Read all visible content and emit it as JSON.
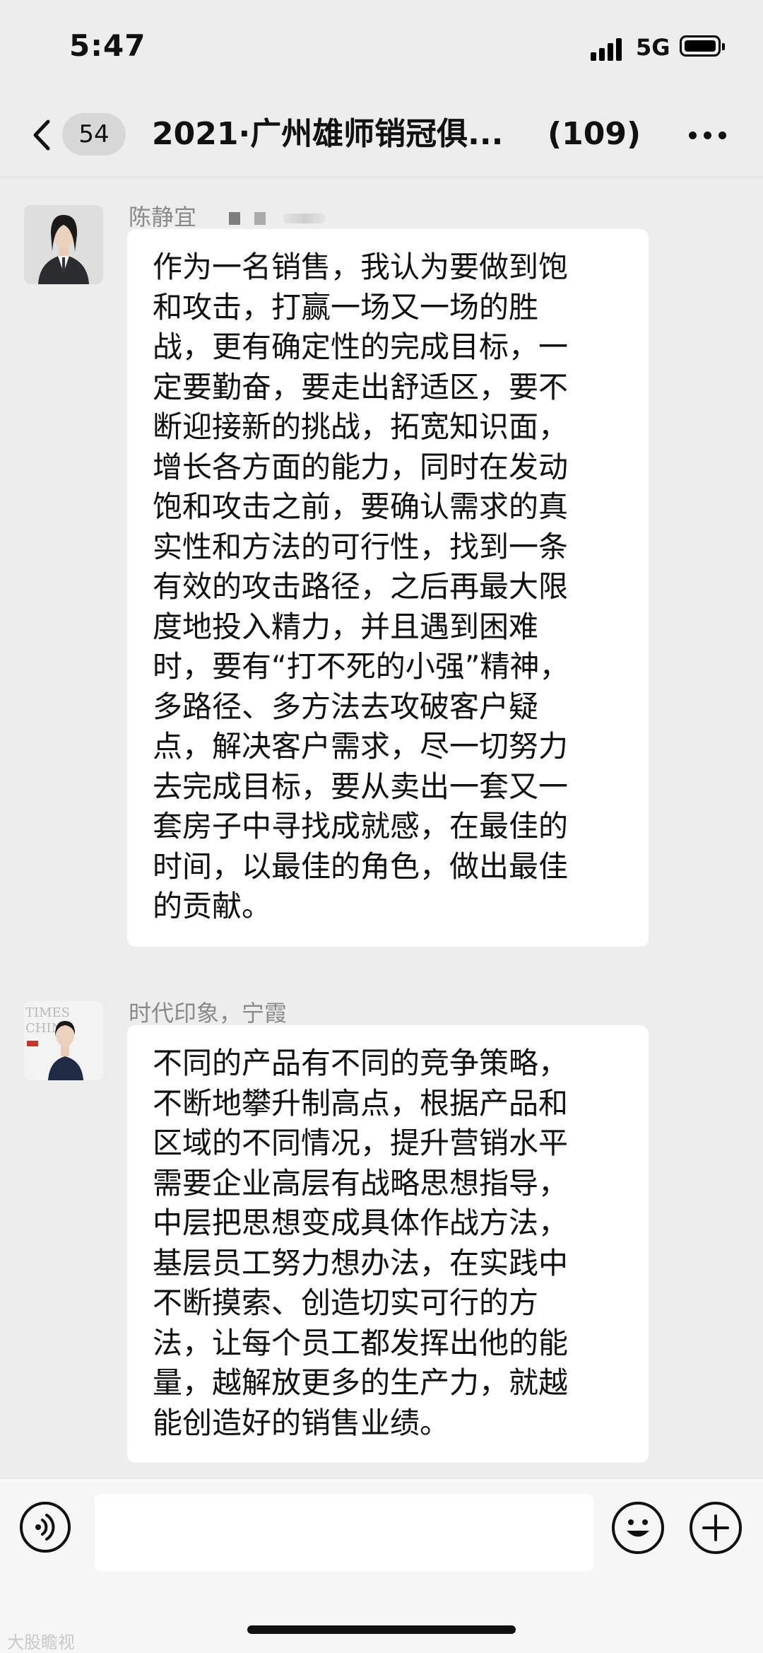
{
  "status_bar": {
    "time": "5:47",
    "network": "5G"
  },
  "header": {
    "unread_count": "54",
    "title": "2021·广州雄师销冠俱...",
    "member_count": "(109)"
  },
  "messages": [
    {
      "sender": "陈静宜",
      "lines": [
        "作为一名销售，我认为要做到饱",
        "和攻击，打赢一场又一场的胜",
        "战，更有确定性的完成目标，一",
        "定要勤奋，要走出舒适区，要不",
        "断迎接新的挑战，拓宽知识面，",
        "增长各方面的能力，同时在发动",
        "饱和攻击之前，要确认需求的真",
        "实性和方法的可行性，找到一条",
        "有效的攻击路径，之后再最大限",
        "度地投入精力，并且遇到困难",
        "时，要有“打不死的小强”精神，",
        "多路径、多方法去攻破客户疑",
        "点，解决客户需求，尽一切努力",
        "去完成目标，要从卖出一套又一",
        "套房子中寻找成就感，在最佳的",
        "时间，以最佳的角色，做出最佳",
        "的贡献。"
      ]
    },
    {
      "sender": "时代印象，宁霞",
      "lines": [
        "不同的产品有不同的竞争策略，",
        "不断地攀升制高点，根据产品和",
        "区域的不同情况，提升营销水平",
        "需要企业高层有战略思想指导，",
        "中层把思想变成具体作战方法，",
        "基层员工努力想办法，在实践中",
        "不断摸索、创造切实可行的方",
        "法，让每个员工都发挥出他的能",
        "量，越解放更多的生产力，就越",
        "能创造好的销售业绩。"
      ]
    }
  ],
  "avatar2_logo_text": "TIMES CHINA",
  "input_bar": {
    "placeholder": ""
  },
  "watermark": "大股瞻视",
  "icons": [
    "back-icon",
    "more-icon",
    "voice-icon",
    "emoji-icon",
    "plus-icon",
    "signal-icon",
    "battery-icon"
  ]
}
